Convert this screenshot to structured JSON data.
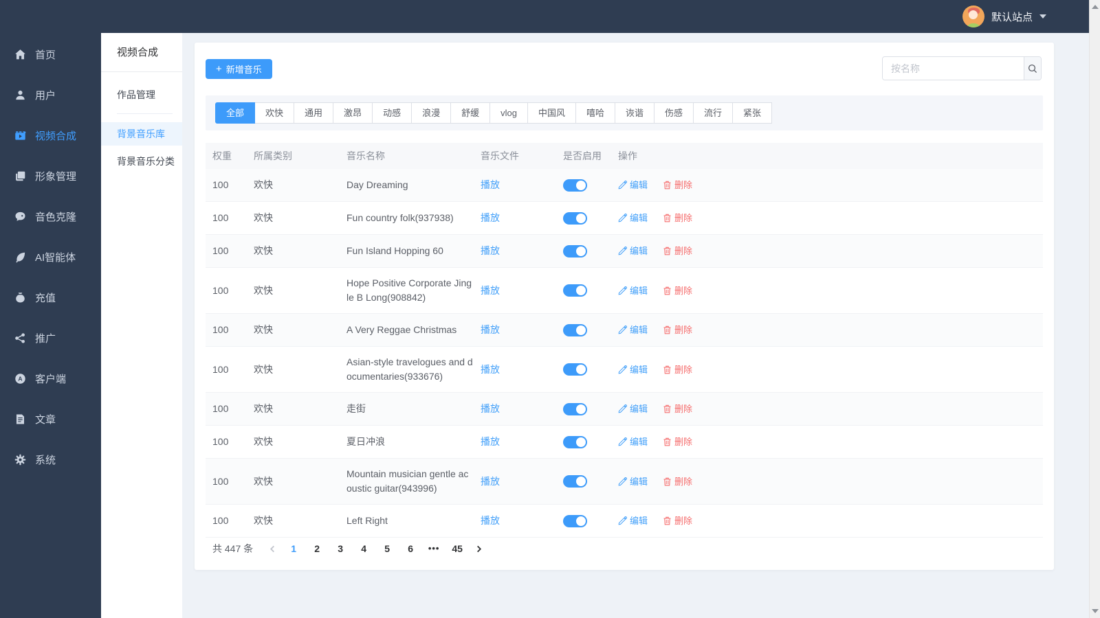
{
  "topbar": {
    "site": "默认站点"
  },
  "sidebar": {
    "items": [
      {
        "label": "首页",
        "icon": "home-icon"
      },
      {
        "label": "用户",
        "icon": "user-icon"
      },
      {
        "label": "视频合成",
        "icon": "video-icon",
        "active": true
      },
      {
        "label": "形象管理",
        "icon": "layers-icon"
      },
      {
        "label": "音色克隆",
        "icon": "voice-icon"
      },
      {
        "label": "AI智能体",
        "icon": "feather-icon"
      },
      {
        "label": "充值",
        "icon": "moneybag-icon"
      },
      {
        "label": "推广",
        "icon": "share-icon"
      },
      {
        "label": "客户端",
        "icon": "appstore-icon"
      },
      {
        "label": "文章",
        "icon": "article-icon"
      },
      {
        "label": "系统",
        "icon": "gear-icon"
      }
    ]
  },
  "submenu": {
    "title": "视频合成",
    "items": [
      {
        "label": "作品管理"
      },
      {
        "label": "背景音乐库",
        "active": true
      },
      {
        "label": "背景音乐分类"
      }
    ]
  },
  "toolbar": {
    "add_button": "新增音乐",
    "add_icon": "+",
    "search_placeholder": "按名称"
  },
  "tabs": {
    "active": "全部",
    "items": [
      "全部",
      "欢快",
      "通用",
      "激昂",
      "动感",
      "浪漫",
      "舒缓",
      "vlog",
      "中国风",
      "嘻哈",
      "诙谐",
      "伤感",
      "流行",
      "紧张"
    ]
  },
  "table": {
    "columns": [
      "权重",
      "所属类别",
      "音乐名称",
      "音乐文件",
      "是否启用",
      "操作"
    ],
    "labels": {
      "play": "播放",
      "edit": "编辑",
      "delete": "删除"
    },
    "rows": [
      {
        "weight": "100",
        "category": "欢快",
        "name": "Day Dreaming",
        "enabled": true
      },
      {
        "weight": "100",
        "category": "欢快",
        "name": "Fun country folk(937938)",
        "enabled": true
      },
      {
        "weight": "100",
        "category": "欢快",
        "name": "Fun Island Hopping 60",
        "enabled": true
      },
      {
        "weight": "100",
        "category": "欢快",
        "name": "Hope Positive Corporate Jingle B Long(908842)",
        "enabled": true
      },
      {
        "weight": "100",
        "category": "欢快",
        "name": "A Very Reggae Christmas",
        "enabled": true
      },
      {
        "weight": "100",
        "category": "欢快",
        "name": "Asian-style travelogues and documentaries(933676)",
        "enabled": true
      },
      {
        "weight": "100",
        "category": "欢快",
        "name": "走街",
        "enabled": true
      },
      {
        "weight": "100",
        "category": "欢快",
        "name": "夏日冲浪",
        "enabled": true
      },
      {
        "weight": "100",
        "category": "欢快",
        "name": "Mountain musician gentle acoustic guitar(943996)",
        "enabled": true
      },
      {
        "weight": "100",
        "category": "欢快",
        "name": "Left Right",
        "enabled": true
      }
    ]
  },
  "pagination": {
    "total": "共 447 条",
    "active": "1",
    "pages": [
      "1",
      "2",
      "3",
      "4",
      "5",
      "6",
      "•••",
      "45"
    ]
  },
  "colors": {
    "accent": "#3d9bfa",
    "danger": "#f56c6c",
    "sidebar_bg": "#2f3d52"
  }
}
